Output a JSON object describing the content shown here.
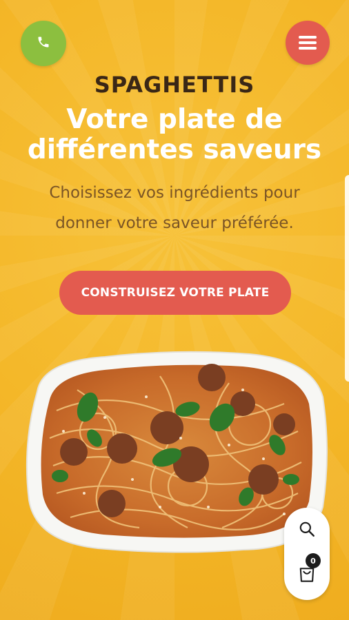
{
  "header": {
    "phone_icon": "phone-icon",
    "menu_icon": "hamburger-icon"
  },
  "hero": {
    "kicker": "SPAGHETTIS",
    "headline_line1": "Votre plate de",
    "headline_line2": "différentes saveurs",
    "subtitle": "Choisissez vos ingrédients pour donner votre saveur préférée.",
    "cta_label": "CONSTRUISEZ VOTRE PLATE"
  },
  "floating_actions": {
    "search_icon": "search-icon",
    "cart_icon": "shopping-bag-icon",
    "cart_count": "0"
  },
  "colors": {
    "background": "#f4b728",
    "phone_button": "#8cbf3f",
    "accent_red": "#e35b4f",
    "kicker_text": "#3a2716",
    "subtitle_text": "#7a5425"
  }
}
